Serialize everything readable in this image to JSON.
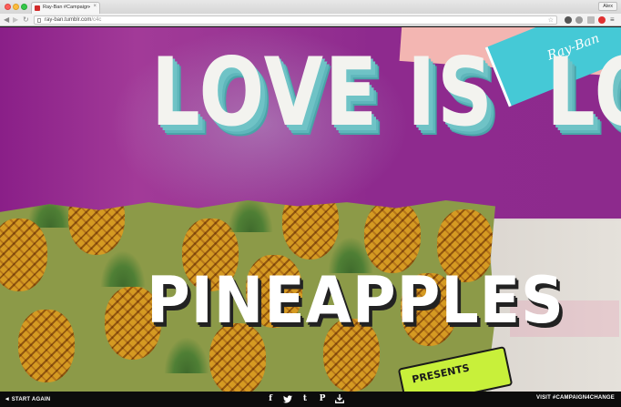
{
  "browser": {
    "tab": {
      "title": "Ray-Ban #Campaign4Cha",
      "close": "×"
    },
    "profile": "Alex",
    "url": {
      "host": "ray-ban.tumblr.com",
      "path": "/c4c"
    },
    "nav": {
      "back": "◀",
      "forward": "▶",
      "reload": "↻",
      "star": "☆",
      "menu": "≡"
    }
  },
  "page": {
    "headline": {
      "left": "IS",
      "main": "LOVE IS",
      "right": "LO"
    },
    "corner_script": "Ray-Ban",
    "card_text": "PINEAPPLES",
    "presents": "PRESENTS",
    "colors": {
      "purple": "#8e2a8e",
      "teal_shadow": "#6fc3c6",
      "lime": "#c8f03a",
      "pineapple_bg": "#8c9a48"
    }
  },
  "footer": {
    "start_again": "START AGAIN",
    "start_arrow": "◂",
    "share": [
      {
        "icon": "facebook-icon",
        "glyph": "f"
      },
      {
        "icon": "twitter-icon",
        "glyph": "🐦"
      },
      {
        "icon": "tumblr-icon",
        "glyph": "t"
      },
      {
        "icon": "pinterest-icon",
        "glyph": "P"
      },
      {
        "icon": "download-icon",
        "glyph": "⤓"
      }
    ],
    "visit": "VISIT #CAMPAIGN4CHANGE"
  }
}
